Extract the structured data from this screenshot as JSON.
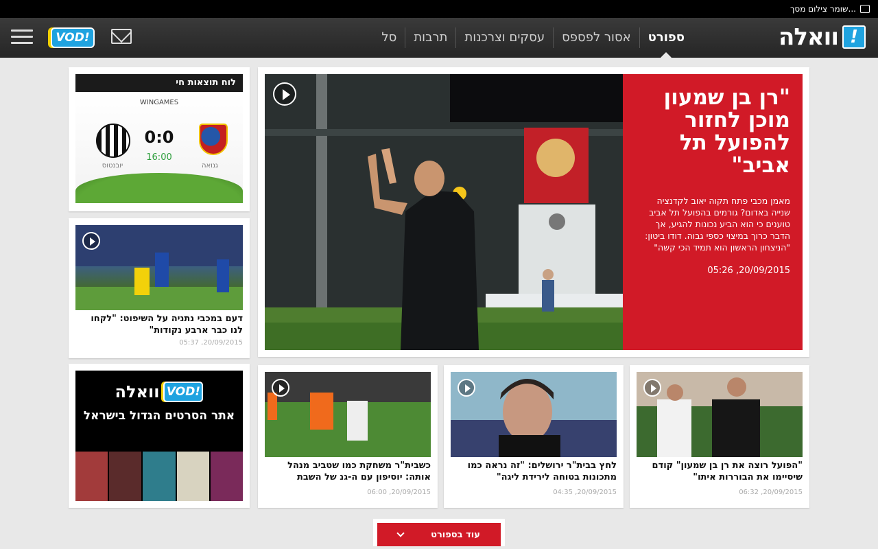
{
  "statusbar": {
    "text": "שומר צילום מסך..."
  },
  "header": {
    "logo_text": "וואלה",
    "logo_badge": "!",
    "vod_label": "VOD!",
    "nav": [
      {
        "label": "ספורט",
        "active": true
      },
      {
        "label": "אסור לפספס"
      },
      {
        "label": "עסקים וצרכנות"
      },
      {
        "label": "תרבות"
      },
      {
        "label": "סל"
      }
    ]
  },
  "hero": {
    "title": "\"רן בן שמעון מוכן לחזור להפועל תל אביב\"",
    "text": "מאמן מכבי פתח תקוה יאוב לקדנציה שנייה באדום? גורמים בהפועל תל אביב טוענים כי הוא הביע נכונות להגיע, אך הדבר כרוך במיצוי כספי גבוה. דודו ביטון: \"הניצחון הראשון הוא תמיד הכי קשה\"",
    "date": "05:26 ,20/09/2015"
  },
  "live": {
    "header": "לוח תוצאות חי",
    "brand": "WINGAMES",
    "score": "0:0",
    "time": "16:00",
    "team_home": "גנואה",
    "team_away": "יובנטוס"
  },
  "articles": [
    {
      "title": "דעם במכבי נתניה על השיפוט: \"לקחו לנו כבר ארבע נקודות\"",
      "date": "05:37 ,20/09/2015"
    },
    {
      "title": "\"הפועל רוצה את רן בן שמעון\" קודם שיסיימו את הבוררות איתו\"",
      "date": "06:32 ,20/09/2015"
    },
    {
      "title": "לחץ בבית\"ר ירושלים: \"זה נראה כמו מתכונות בטוחה לירידת ליגה\"",
      "date": "04:35 ,20/09/2015"
    },
    {
      "title": "כשבית\"ר משחקת כמו שטביב מנהל אותה: יוסיפון עם ה-גנ של השבת",
      "date": "06:00 ,20/09/2015"
    }
  ],
  "ad": {
    "vod": "VOD!",
    "walla": "וואלה",
    "tagline": "אתר הסרטים הגדול בישראל"
  },
  "more_button": {
    "label": "עוד בספורט"
  }
}
